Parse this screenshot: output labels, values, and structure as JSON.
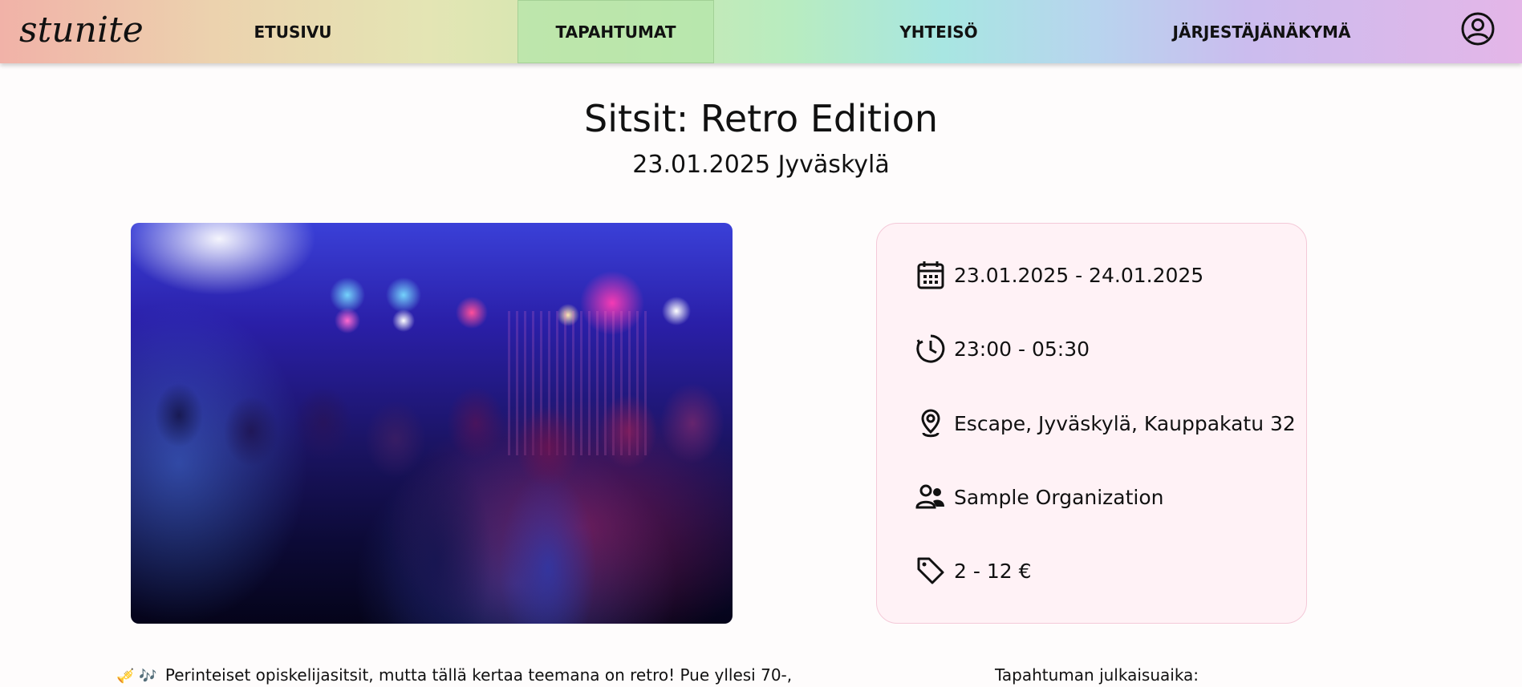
{
  "navbar": {
    "logo": "stunite",
    "items": [
      {
        "label": "ETUSIVU"
      },
      {
        "label": "TAPAHTUMAT",
        "active": true
      },
      {
        "label": "YHTEISÖ"
      },
      {
        "label": "JÄRJESTÄJÄNÄKYMÄ"
      }
    ],
    "profile_icon": "user-circle-icon"
  },
  "event": {
    "title": "Sitsit: Retro Edition",
    "subtitle": "23.01.2025 Jyväskylä",
    "image_subject": "party-crowd-photo",
    "details": {
      "dates": "23.01.2025 - 24.01.2025",
      "time": "23:00 - 05:30",
      "location": "Escape, Jyväskylä, Kauppakatu 32",
      "organizer": "Sample Organization",
      "price": "2 - 12 €"
    },
    "description_emoji": "🎺 🎶",
    "description": "Perinteiset opiskelijasitsit, mutta tällä kertaa teemana on retro! Pue yllesi 70-,",
    "published_label": "Tapahtuman julkaisuaika:"
  },
  "colors": {
    "card_background": "#fff2f6",
    "card_border": "#f4c9d8",
    "active_tab": "#b8e6a8"
  }
}
